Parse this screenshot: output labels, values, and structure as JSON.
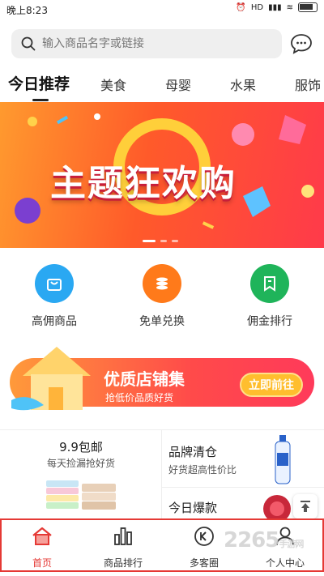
{
  "status_bar": {
    "time": "晚上8:23",
    "network": "HD",
    "battery": "4G"
  },
  "search": {
    "placeholder": "输入商品名字或链接"
  },
  "tabs": [
    {
      "label": "今日推荐",
      "active": true
    },
    {
      "label": "美食"
    },
    {
      "label": "母婴"
    },
    {
      "label": "水果"
    },
    {
      "label": "服饰"
    }
  ],
  "banner": {
    "title": "主题狂欢购"
  },
  "quick_links": [
    {
      "label": "高佣商品",
      "icon": "bag-icon",
      "color": "#2aa8f2"
    },
    {
      "label": "免单兑换",
      "icon": "coins-icon",
      "color": "#ff7a1a"
    },
    {
      "label": "佣金排行",
      "icon": "bookmark-icon",
      "color": "#1fb45a"
    }
  ],
  "promo": {
    "title": "优质店铺集",
    "subtitle": "抢低价品质好货",
    "button": "立即前往"
  },
  "featured": {
    "left": {
      "title": "9.9包邮",
      "subtitle": "每天捡漏抢好货"
    },
    "right_top": {
      "title": "品牌清仓",
      "subtitle": "好货超高性价比"
    },
    "right_bottom": {
      "title": "今日爆款"
    }
  },
  "nav": [
    {
      "label": "首页",
      "icon": "home-icon",
      "active": true
    },
    {
      "label": "商品排行",
      "icon": "bar-chart-icon"
    },
    {
      "label": "多客圈",
      "icon": "circle-back-icon"
    },
    {
      "label": "个人中心",
      "icon": "person-icon"
    }
  ],
  "watermark": "2265",
  "watermark_sub": "手游网",
  "colors": {
    "accent": "#e53935",
    "search_bg": "#efefef"
  }
}
